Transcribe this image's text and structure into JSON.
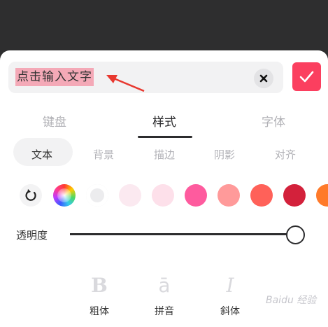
{
  "input": {
    "text": "点击输入文字"
  },
  "confirm": {
    "icon": "check-icon",
    "color": "#fb3f5f"
  },
  "tabs": [
    {
      "label": "键盘",
      "active": false
    },
    {
      "label": "样式",
      "active": true
    },
    {
      "label": "字体",
      "active": false
    }
  ],
  "subtabs": [
    {
      "label": "文本",
      "active": true
    },
    {
      "label": "背景",
      "active": false
    },
    {
      "label": "描边",
      "active": false
    },
    {
      "label": "阴影",
      "active": false
    },
    {
      "label": "对齐",
      "active": false
    }
  ],
  "colors": [
    "#ececee",
    "#fbe9f0",
    "#fde0ea",
    "#fe5b9e",
    "#ff9a9a",
    "#ff6159",
    "#d3213b",
    "#ff7a2a"
  ],
  "opacity": {
    "label": "透明度",
    "value": 1.0
  },
  "format_buttons": [
    {
      "label": "粗体",
      "icon": "bold-icon"
    },
    {
      "label": "拼音",
      "icon": "pinyin-icon"
    },
    {
      "label": "斜体",
      "icon": "italic-icon"
    }
  ],
  "watermark": "Baidu 经验"
}
